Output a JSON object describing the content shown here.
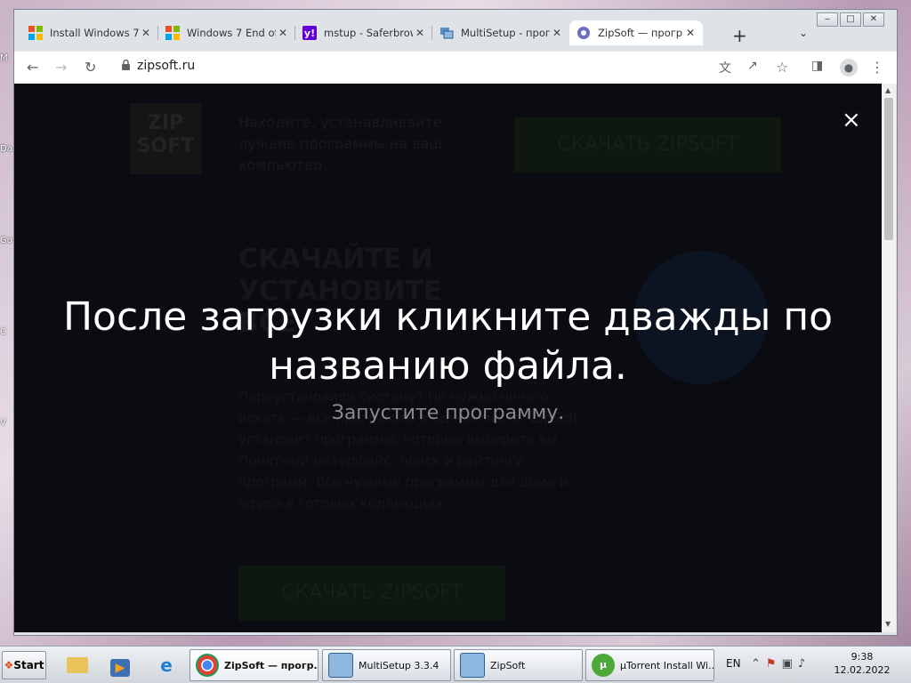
{
  "desktop": {
    "labels": [
      "M",
      "Da",
      "Go",
      "C",
      "V"
    ]
  },
  "window": {
    "controls": [
      "minimize",
      "maximize",
      "close"
    ]
  },
  "tabs": [
    {
      "title": "Install Windows 7",
      "icon": "windows-logo-icon"
    },
    {
      "title": "Windows 7 End of",
      "icon": "windows-logo-icon"
    },
    {
      "title": "mstup - Saferbrow",
      "icon": "yahoo-icon"
    },
    {
      "title": "MultiSetup - прогр",
      "icon": "multisetup-icon"
    },
    {
      "title": "ZipSoft — програ",
      "icon": "zipsoft-icon",
      "active": true
    }
  ],
  "toolbar": {
    "url": "zipsoft.ru"
  },
  "site": {
    "logo": "ZIP SOFT",
    "tagline": "Находите, устанавливайте лучшие программы на ваш компьютер",
    "download_label": "СКАЧАТЬ ZIPSOFT",
    "hero_title": "СКАЧАЙТЕ И УСТАНОВИТЕ ВСЕ",
    "hero_body": "Переустановили систему? Не нужно ничего искать — все программы в одном месте. ZipSoft установит программы, которые выберете вы. Понятный интерфейс, поиск и рейтинги программ. Все нужные программы для дома и офиса в готовых коллекциях.",
    "download_label_2": "СКАЧАТЬ ZIPSOFT"
  },
  "overlay": {
    "close": "×",
    "title": "После загрузки кликните дважды по названию файла.",
    "subtitle": "Запустите программу."
  },
  "taskbar": {
    "start": "Start",
    "buttons": [
      {
        "label": "ZipSoft — прогр...",
        "active": true
      },
      {
        "label": "MultiSetup 3.3.4"
      },
      {
        "label": "ZipSoft"
      },
      {
        "label": "µTorrent Install Wi..."
      }
    ],
    "language": "EN",
    "time": "9:38",
    "date": "12.02.2022"
  },
  "colors": {
    "chrome_blue": "#1a73e8",
    "overlay_bg": "#0b0c11",
    "download_green": "#0e1710"
  }
}
